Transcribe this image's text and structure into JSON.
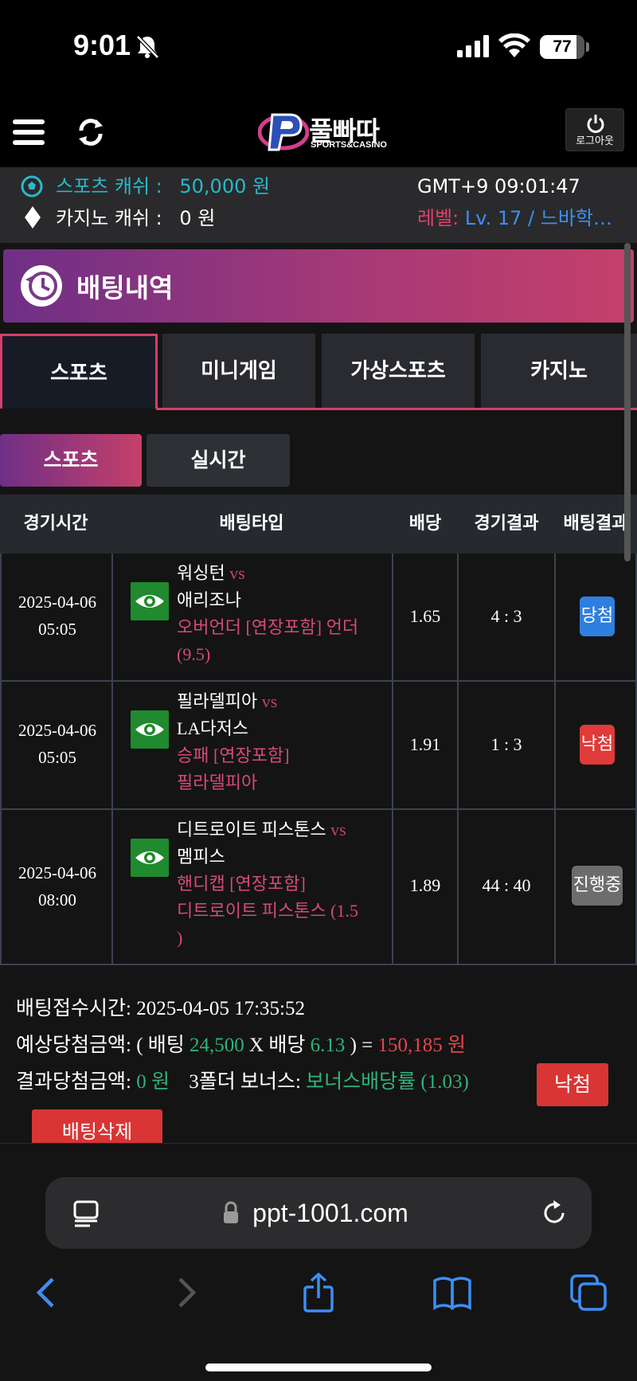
{
  "status_bar": {
    "time": "9:01",
    "battery": "77"
  },
  "header": {
    "logo_text": "풀빠따",
    "logo_sub": "SPORTS&CASINO",
    "logout_label": "로그아웃"
  },
  "info": {
    "sports_cash_label": "스포츠 캐쉬 :",
    "sports_cash_value": "50,000 원",
    "casino_cash_label": "카지노 캐쉬 :",
    "casino_cash_value": "0 원",
    "clock": "GMT+9 09:01:47",
    "level_label": "레벨:",
    "level_value": "Lv. 17 / 느바학…"
  },
  "banner": {
    "title": "배팅내역"
  },
  "tabs": [
    {
      "label": "스포츠",
      "active": true
    },
    {
      "label": "미니게임",
      "active": false
    },
    {
      "label": "가상스포츠",
      "active": false
    },
    {
      "label": "카지노",
      "active": false
    }
  ],
  "subtabs": [
    {
      "label": "스포츠",
      "active": true
    },
    {
      "label": "실시간",
      "active": false
    }
  ],
  "table": {
    "headers": [
      "경기시간",
      "배팅타입",
      "배당",
      "경기결과",
      "배팅결과"
    ],
    "rows": [
      {
        "date": "2025-04-06",
        "time": "05:05",
        "home": "워싱턴",
        "vs": "vs",
        "away": "애리조나",
        "type_line1": "오버언더 [연장포함] 언더",
        "type_line2": "(9.5)",
        "odds": "1.65",
        "score": "4 : 3",
        "result": "당첨",
        "result_kind": "win"
      },
      {
        "date": "2025-04-06",
        "time": "05:05",
        "home": "필라델피아",
        "vs": "vs",
        "away": "LA다저스",
        "type_line1": "승패 [연장포함]",
        "type_line2": "필라델피아",
        "odds": "1.91",
        "score": "1 : 3",
        "result": "낙첨",
        "result_kind": "lose"
      },
      {
        "date": "2025-04-06",
        "time": "08:00",
        "home": "디트로이트 피스톤스",
        "vs": "vs",
        "away": "멤피스",
        "type_line1": "핸디캡 [연장포함]",
        "type_line2": "디트로이트 피스톤스 (1.5",
        "type_line3": ")",
        "odds": "1.89",
        "score": "44 : 40",
        "result": "진행중",
        "result_kind": "progress"
      }
    ]
  },
  "summary": {
    "received_label": "배팅접수시간:",
    "received_value": "2025-04-05 17:35:52",
    "expected_label": "예상당첨금액: ( 배팅",
    "bet_amount": "24,500",
    "x_label": "X 배당",
    "total_odds": "6.13",
    "eq_label": ") =",
    "expected_win": "150,185 원",
    "result_label": "결과당첨금액:",
    "result_value": "0 원",
    "bonus_label": "3폴더 보너스:",
    "bonus_value": "보너스배당률 (1.03)",
    "status_button": "낙첨",
    "delete_button": "배팅삭제"
  },
  "browser": {
    "url": "ppt-1001.com"
  }
}
